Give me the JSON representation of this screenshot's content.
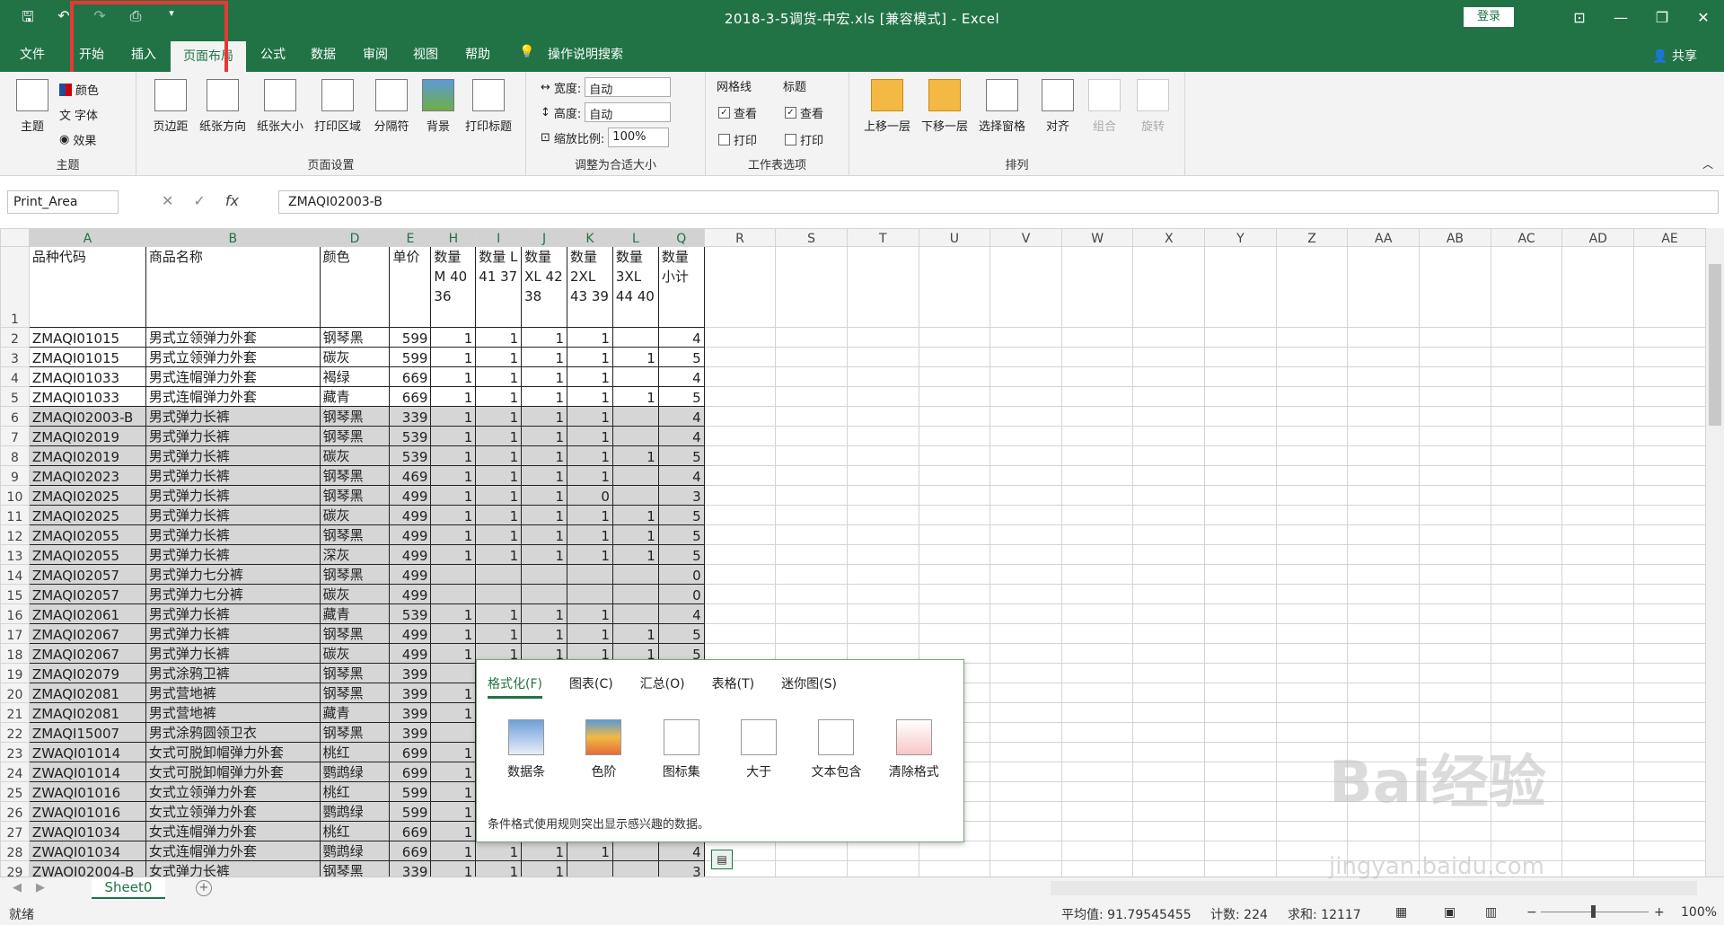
{
  "window": {
    "title": "2018-3-5调货-中宏.xls  [兼容模式]  -  Excel",
    "login": "登录"
  },
  "qat": {
    "icons": [
      "save-icon",
      "undo-icon",
      "redo-icon",
      "print-preview-icon",
      "customize-icon"
    ]
  },
  "tabs": [
    "文件",
    "开始",
    "插入",
    "页面布局",
    "公式",
    "数据",
    "审阅",
    "视图",
    "帮助",
    "操作说明搜索"
  ],
  "active_tab": "页面布局",
  "share": "共享",
  "ribbon": {
    "theme": {
      "name": "主题",
      "buttons": [
        "主题"
      ],
      "small": [
        "颜色",
        "字体",
        "效果"
      ]
    },
    "page_setup": {
      "name": "页面设置",
      "buttons": [
        "页边距",
        "纸张方向",
        "纸张大小",
        "打印区域",
        "分隔符",
        "背景",
        "打印标题"
      ]
    },
    "scale": {
      "name": "调整为合适大小",
      "width_label": "宽度:",
      "width_value": "自动",
      "height_label": "高度:",
      "height_value": "自动",
      "scale_label": "缩放比例:",
      "scale_value": "100%"
    },
    "sheet_options": {
      "name": "工作表选项",
      "gridlines": "网格线",
      "headings": "标题",
      "view": "查看",
      "print": "打印"
    },
    "arrange": {
      "name": "排列",
      "buttons": [
        "上移一层",
        "下移一层",
        "选择窗格",
        "对齐",
        "组合",
        "旋转"
      ]
    }
  },
  "namebox": "Print_Area",
  "formula": "ZMAQI02003-B",
  "columns": [
    "A",
    "B",
    "D",
    "E",
    "H",
    "I",
    "J",
    "K",
    "L",
    "Q",
    "R",
    "S",
    "T",
    "U",
    "V",
    "W",
    "X",
    "Y",
    "Z",
    "AA",
    "AB",
    "AC",
    "AD",
    "AE"
  ],
  "header": {
    "a": "品种代码",
    "b": "商品名称",
    "d": "颜色",
    "e": "单价",
    "h": "数量\nM\n40\n36",
    "i": "数量\nL\n41\n37",
    "j": "数量\nXL\n42\n38",
    "k": "数量\n2XL\n43\n39",
    "l": "数量\n3XL\n44\n40",
    "q": "数量\n小计"
  },
  "rows": [
    {
      "n": "2",
      "a": "ZMAQI01015",
      "b": "男式立领弹力外套",
      "d": "钢琴黑",
      "e": "599",
      "h": "1",
      "i": "1",
      "j": "1",
      "k": "1",
      "l": "",
      "q": "4"
    },
    {
      "n": "3",
      "a": "ZMAQI01015",
      "b": "男式立领弹力外套",
      "d": "碳灰",
      "e": "599",
      "h": "1",
      "i": "1",
      "j": "1",
      "k": "1",
      "l": "1",
      "q": "5"
    },
    {
      "n": "4",
      "a": "ZMAQI01033",
      "b": "男式连帽弹力外套",
      "d": "褐绿",
      "e": "669",
      "h": "1",
      "i": "1",
      "j": "1",
      "k": "1",
      "l": "",
      "q": "4"
    },
    {
      "n": "5",
      "a": "ZMAQI01033",
      "b": "男式连帽弹力外套",
      "d": "藏青",
      "e": "669",
      "h": "1",
      "i": "1",
      "j": "1",
      "k": "1",
      "l": "1",
      "q": "5"
    },
    {
      "n": "6",
      "a": "ZMAQI02003-B",
      "b": "男式弹力长裤",
      "d": "钢琴黑",
      "e": "339",
      "h": "1",
      "i": "1",
      "j": "1",
      "k": "1",
      "l": "",
      "q": "4"
    },
    {
      "n": "7",
      "a": "ZMAQI02019",
      "b": "男式弹力长裤",
      "d": "钢琴黑",
      "e": "539",
      "h": "1",
      "i": "1",
      "j": "1",
      "k": "1",
      "l": "",
      "q": "4"
    },
    {
      "n": "8",
      "a": "ZMAQI02019",
      "b": "男式弹力长裤",
      "d": "碳灰",
      "e": "539",
      "h": "1",
      "i": "1",
      "j": "1",
      "k": "1",
      "l": "1",
      "q": "5"
    },
    {
      "n": "9",
      "a": "ZMAQI02023",
      "b": "男式弹力长裤",
      "d": "钢琴黑",
      "e": "469",
      "h": "1",
      "i": "1",
      "j": "1",
      "k": "1",
      "l": "",
      "q": "4"
    },
    {
      "n": "10",
      "a": "ZMAQI02025",
      "b": "男式弹力长裤",
      "d": "钢琴黑",
      "e": "499",
      "h": "1",
      "i": "1",
      "j": "1",
      "k": "0",
      "l": "",
      "q": "3"
    },
    {
      "n": "11",
      "a": "ZMAQI02025",
      "b": "男式弹力长裤",
      "d": "碳灰",
      "e": "499",
      "h": "1",
      "i": "1",
      "j": "1",
      "k": "1",
      "l": "1",
      "q": "5"
    },
    {
      "n": "12",
      "a": "ZMAQI02055",
      "b": "男式弹力长裤",
      "d": "钢琴黑",
      "e": "499",
      "h": "1",
      "i": "1",
      "j": "1",
      "k": "1",
      "l": "1",
      "q": "5"
    },
    {
      "n": "13",
      "a": "ZMAQI02055",
      "b": "男式弹力长裤",
      "d": "深灰",
      "e": "499",
      "h": "1",
      "i": "1",
      "j": "1",
      "k": "1",
      "l": "1",
      "q": "5"
    },
    {
      "n": "14",
      "a": "ZMAQI02057",
      "b": "男式弹力七分裤",
      "d": "钢琴黑",
      "e": "499",
      "h": "",
      "i": "",
      "j": "",
      "k": "",
      "l": "",
      "q": "0"
    },
    {
      "n": "15",
      "a": "ZMAQI02057",
      "b": "男式弹力七分裤",
      "d": "碳灰",
      "e": "499",
      "h": "",
      "i": "",
      "j": "",
      "k": "",
      "l": "",
      "q": "0"
    },
    {
      "n": "16",
      "a": "ZMAQI02061",
      "b": "男式弹力长裤",
      "d": "藏青",
      "e": "539",
      "h": "1",
      "i": "1",
      "j": "1",
      "k": "1",
      "l": "",
      "q": "4"
    },
    {
      "n": "17",
      "a": "ZMAQI02067",
      "b": "男式弹力长裤",
      "d": "钢琴黑",
      "e": "499",
      "h": "1",
      "i": "1",
      "j": "1",
      "k": "1",
      "l": "1",
      "q": "5"
    },
    {
      "n": "18",
      "a": "ZMAQI02067",
      "b": "男式弹力长裤",
      "d": "碳灰",
      "e": "499",
      "h": "1",
      "i": "1",
      "j": "1",
      "k": "1",
      "l": "1",
      "q": "5"
    },
    {
      "n": "19",
      "a": "ZMAQI02079",
      "b": "男式涂鸦卫裤",
      "d": "钢琴黑",
      "e": "399",
      "h": "",
      "i": "",
      "j": "",
      "k": "",
      "l": "",
      "q": ""
    },
    {
      "n": "20",
      "a": "ZMAQI02081",
      "b": "男式营地裤",
      "d": "钢琴黑",
      "e": "399",
      "h": "1",
      "i": "",
      "j": "",
      "k": "",
      "l": "",
      "q": ""
    },
    {
      "n": "21",
      "a": "ZMAQI02081",
      "b": "男式营地裤",
      "d": "藏青",
      "e": "399",
      "h": "1",
      "i": "",
      "j": "",
      "k": "",
      "l": "",
      "q": ""
    },
    {
      "n": "22",
      "a": "ZMAQI15007",
      "b": "男式涂鸦圆领卫衣",
      "d": "钢琴黑",
      "e": "399",
      "h": "",
      "i": "",
      "j": "",
      "k": "",
      "l": "",
      "q": ""
    },
    {
      "n": "23",
      "a": "ZWAQI01014",
      "b": "女式可脱卸帽弹力外套",
      "d": "桃红",
      "e": "699",
      "h": "1",
      "i": "",
      "j": "",
      "k": "",
      "l": "",
      "q": ""
    },
    {
      "n": "24",
      "a": "ZWAQI01014",
      "b": "女式可脱卸帽弹力外套",
      "d": "鹦鹉绿",
      "e": "699",
      "h": "1",
      "i": "",
      "j": "",
      "k": "",
      "l": "",
      "q": ""
    },
    {
      "n": "25",
      "a": "ZWAQI01016",
      "b": "女式立领弹力外套",
      "d": "桃红",
      "e": "599",
      "h": "1",
      "i": "",
      "j": "",
      "k": "",
      "l": "",
      "q": ""
    },
    {
      "n": "26",
      "a": "ZWAQI01016",
      "b": "女式立领弹力外套",
      "d": "鹦鹉绿",
      "e": "599",
      "h": "1",
      "i": "",
      "j": "",
      "k": "",
      "l": "",
      "q": ""
    },
    {
      "n": "27",
      "a": "ZWAQI01034",
      "b": "女式连帽弹力外套",
      "d": "桃红",
      "e": "669",
      "h": "1",
      "i": "",
      "j": "",
      "k": "",
      "l": "",
      "q": ""
    },
    {
      "n": "28",
      "a": "ZWAQI01034",
      "b": "女式连帽弹力外套",
      "d": "鹦鹉绿",
      "e": "669",
      "h": "1",
      "i": "1",
      "j": "1",
      "k": "1",
      "l": "",
      "q": "4"
    },
    {
      "n": "29",
      "a": "ZWAQI02004-B",
      "b": "女式弹力长裤",
      "d": "钢琴黑",
      "e": "339",
      "h": "1",
      "i": "1",
      "j": "1",
      "k": "",
      "l": "",
      "q": "3"
    }
  ],
  "quick_analysis": {
    "tabs": [
      "格式化(F)",
      "图表(C)",
      "汇总(O)",
      "表格(T)",
      "迷你图(S)"
    ],
    "items": [
      "数据条",
      "色阶",
      "图标集",
      "大于",
      "文本包含",
      "清除格式"
    ],
    "description": "条件格式使用规则突出显示感兴趣的数据。"
  },
  "sheet_tab": "Sheet0",
  "status": {
    "ready": "就绪",
    "average": "平均值: 91.79545455",
    "count": "计数: 224",
    "sum": "求和: 12117",
    "zoom": "100%"
  },
  "watermark": {
    "main": "Bai经验",
    "sub": "jingyan.baidu.com"
  },
  "colors": {
    "excel_green": "#217346",
    "highlight_box": "#e53935",
    "selection_fill": "#d6d6d6"
  }
}
